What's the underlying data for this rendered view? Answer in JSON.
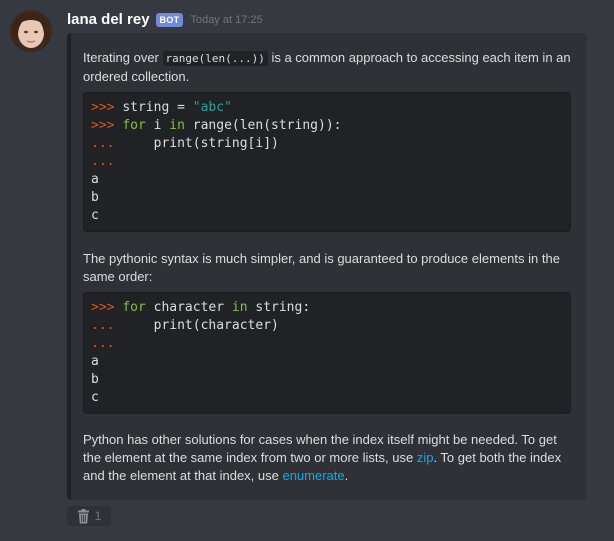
{
  "message": {
    "username": "lana del rey",
    "bot_tag": "BOT",
    "timestamp": "Today at 17:25"
  },
  "embed": {
    "para1_before": "Iterating over ",
    "para1_code": "range(len(...))",
    "para1_after": " is a common approach to accessing each item in an ordered collection.",
    "code_block_1": [
      {
        "prompt": ">>> ",
        "parts": [
          {
            "t": "string = ",
            "c": "plain"
          },
          {
            "t": "\"abc\"",
            "c": "str"
          }
        ]
      },
      {
        "prompt": ">>> ",
        "parts": [
          {
            "t": "for",
            "c": "kw"
          },
          {
            "t": " i ",
            "c": "plain"
          },
          {
            "t": "in",
            "c": "kw"
          },
          {
            "t": " range(len(string)):",
            "c": "plain"
          }
        ]
      },
      {
        "prompt": "...",
        "parts": [
          {
            "t": "     print(string[i])",
            "c": "plain"
          }
        ]
      },
      {
        "prompt": "...",
        "parts": []
      },
      {
        "prompt": "",
        "parts": [
          {
            "t": "a",
            "c": "plain"
          }
        ]
      },
      {
        "prompt": "",
        "parts": [
          {
            "t": "b",
            "c": "plain"
          }
        ]
      },
      {
        "prompt": "",
        "parts": [
          {
            "t": "c",
            "c": "plain"
          }
        ]
      }
    ],
    "para2": "The pythonic syntax is much simpler, and is guaranteed to produce elements in the same order:",
    "code_block_2": [
      {
        "prompt": ">>> ",
        "parts": [
          {
            "t": "for",
            "c": "kw"
          },
          {
            "t": " character ",
            "c": "plain"
          },
          {
            "t": "in",
            "c": "kw"
          },
          {
            "t": " string:",
            "c": "plain"
          }
        ]
      },
      {
        "prompt": "...",
        "parts": [
          {
            "t": "     print(character)",
            "c": "plain"
          }
        ]
      },
      {
        "prompt": "...",
        "parts": []
      },
      {
        "prompt": "",
        "parts": [
          {
            "t": "a",
            "c": "plain"
          }
        ]
      },
      {
        "prompt": "",
        "parts": [
          {
            "t": "b",
            "c": "plain"
          }
        ]
      },
      {
        "prompt": "",
        "parts": [
          {
            "t": "c",
            "c": "plain"
          }
        ]
      }
    ],
    "para3_a": "Python has other solutions for cases when the index itself might be needed. To get the element at the same index from two or more lists, use ",
    "para3_link1": "zip",
    "para3_b": ". To get both the index and the element at that index, use ",
    "para3_link2": "enumerate",
    "para3_c": "."
  },
  "reaction": {
    "icon": "wastebasket-icon",
    "count": "1"
  },
  "colors": {
    "background": "#36393f",
    "embed_bg": "#2f3136",
    "code_bg": "#202225",
    "prompt": "#e5540b",
    "keyword": "#85c03f",
    "string": "#2aa198",
    "link": "#00b0f4",
    "bot_tag": "#7289da"
  }
}
